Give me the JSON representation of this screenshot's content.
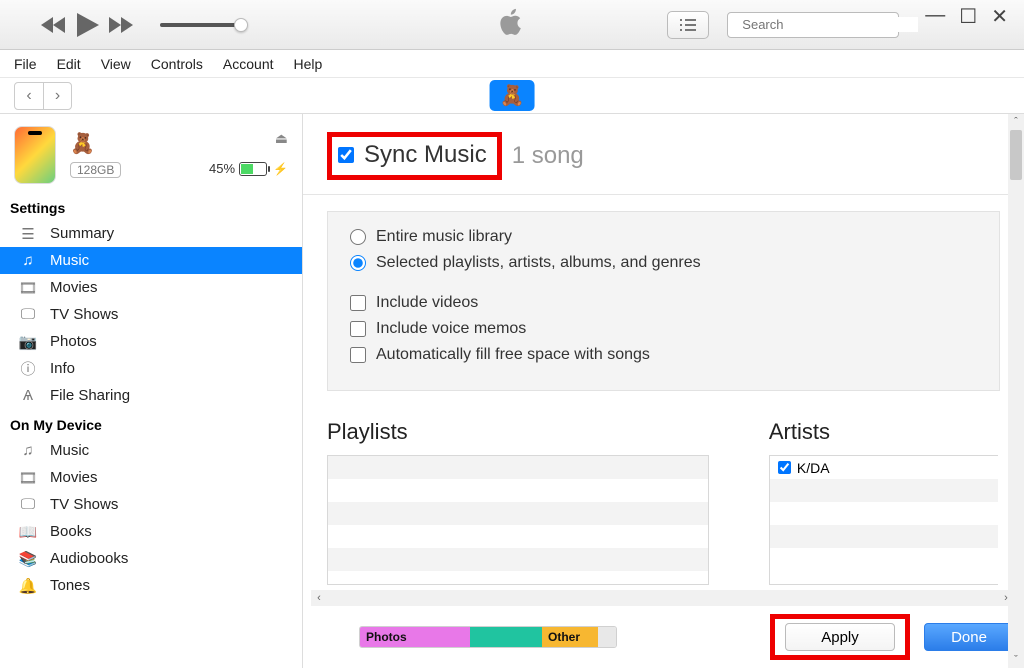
{
  "search": {
    "placeholder": "Search"
  },
  "menu": {
    "file": "File",
    "edit": "Edit",
    "view": "View",
    "controls": "Controls",
    "account": "Account",
    "help": "Help"
  },
  "device": {
    "capacity": "128GB",
    "battery_pct": "45%"
  },
  "settings": {
    "header": "Settings",
    "items": {
      "summary": "Summary",
      "music": "Music",
      "movies": "Movies",
      "tvshows": "TV Shows",
      "photos": "Photos",
      "info": "Info",
      "filesharing": "File Sharing"
    }
  },
  "ondevice": {
    "header": "On My Device",
    "items": {
      "music": "Music",
      "movies": "Movies",
      "tvshows": "TV Shows",
      "books": "Books",
      "audiobooks": "Audiobooks",
      "tones": "Tones"
    }
  },
  "sync": {
    "title": "Sync Music",
    "count": "1 song",
    "opt_entire": "Entire music library",
    "opt_selected": "Selected playlists, artists, albums, and genres",
    "opt_videos": "Include videos",
    "opt_voice": "Include voice memos",
    "opt_autofill": "Automatically fill free space with songs"
  },
  "lists": {
    "playlists_title": "Playlists",
    "artists_title": "Artists",
    "artist0": "K/DA"
  },
  "storage": {
    "seg1": "Photos",
    "seg3": "Other"
  },
  "buttons": {
    "apply": "Apply",
    "done": "Done"
  }
}
